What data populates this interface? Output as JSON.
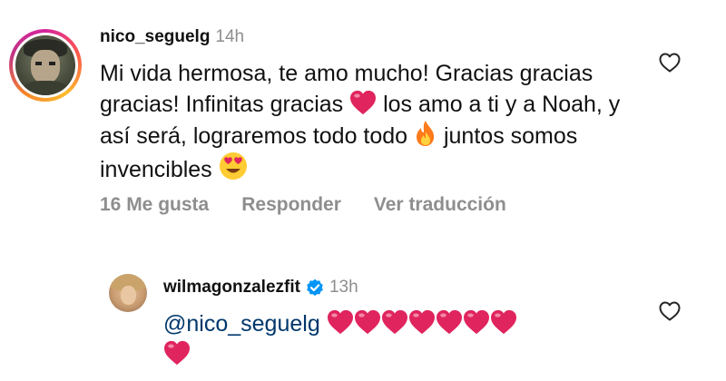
{
  "comments": [
    {
      "username": "nico_seguelg",
      "time": "14h",
      "text_parts": {
        "p1": "Mi vida hermosa, te amo mucho! Gracias gracias gracias! Infinitas gracias ",
        "p2": " los amo a ti y a Noah, y así será, lograremos todo todo ",
        "p3": " juntos somos invencibles "
      },
      "emojis": [
        "red-heart",
        "fire",
        "smiling-face-with-heart-eyes"
      ],
      "actions": {
        "likes": "16 Me gusta",
        "reply": "Responder",
        "translate": "Ver traducción"
      }
    },
    {
      "username": "wilmagonzalezfit",
      "time": "13h",
      "verified": true,
      "mention": "@nico_seguelg",
      "emojis": [
        "red-heart",
        "red-heart",
        "red-heart",
        "red-heart",
        "red-heart",
        "red-heart",
        "red-heart",
        "red-heart"
      ]
    }
  ],
  "colors": {
    "text": "#111111",
    "muted": "#8e8e8e",
    "mention": "#00376b",
    "verified": "#0095f6",
    "heart": "#e0245e"
  },
  "icons": [
    "heart-outline-icon",
    "verified-badge-icon"
  ]
}
